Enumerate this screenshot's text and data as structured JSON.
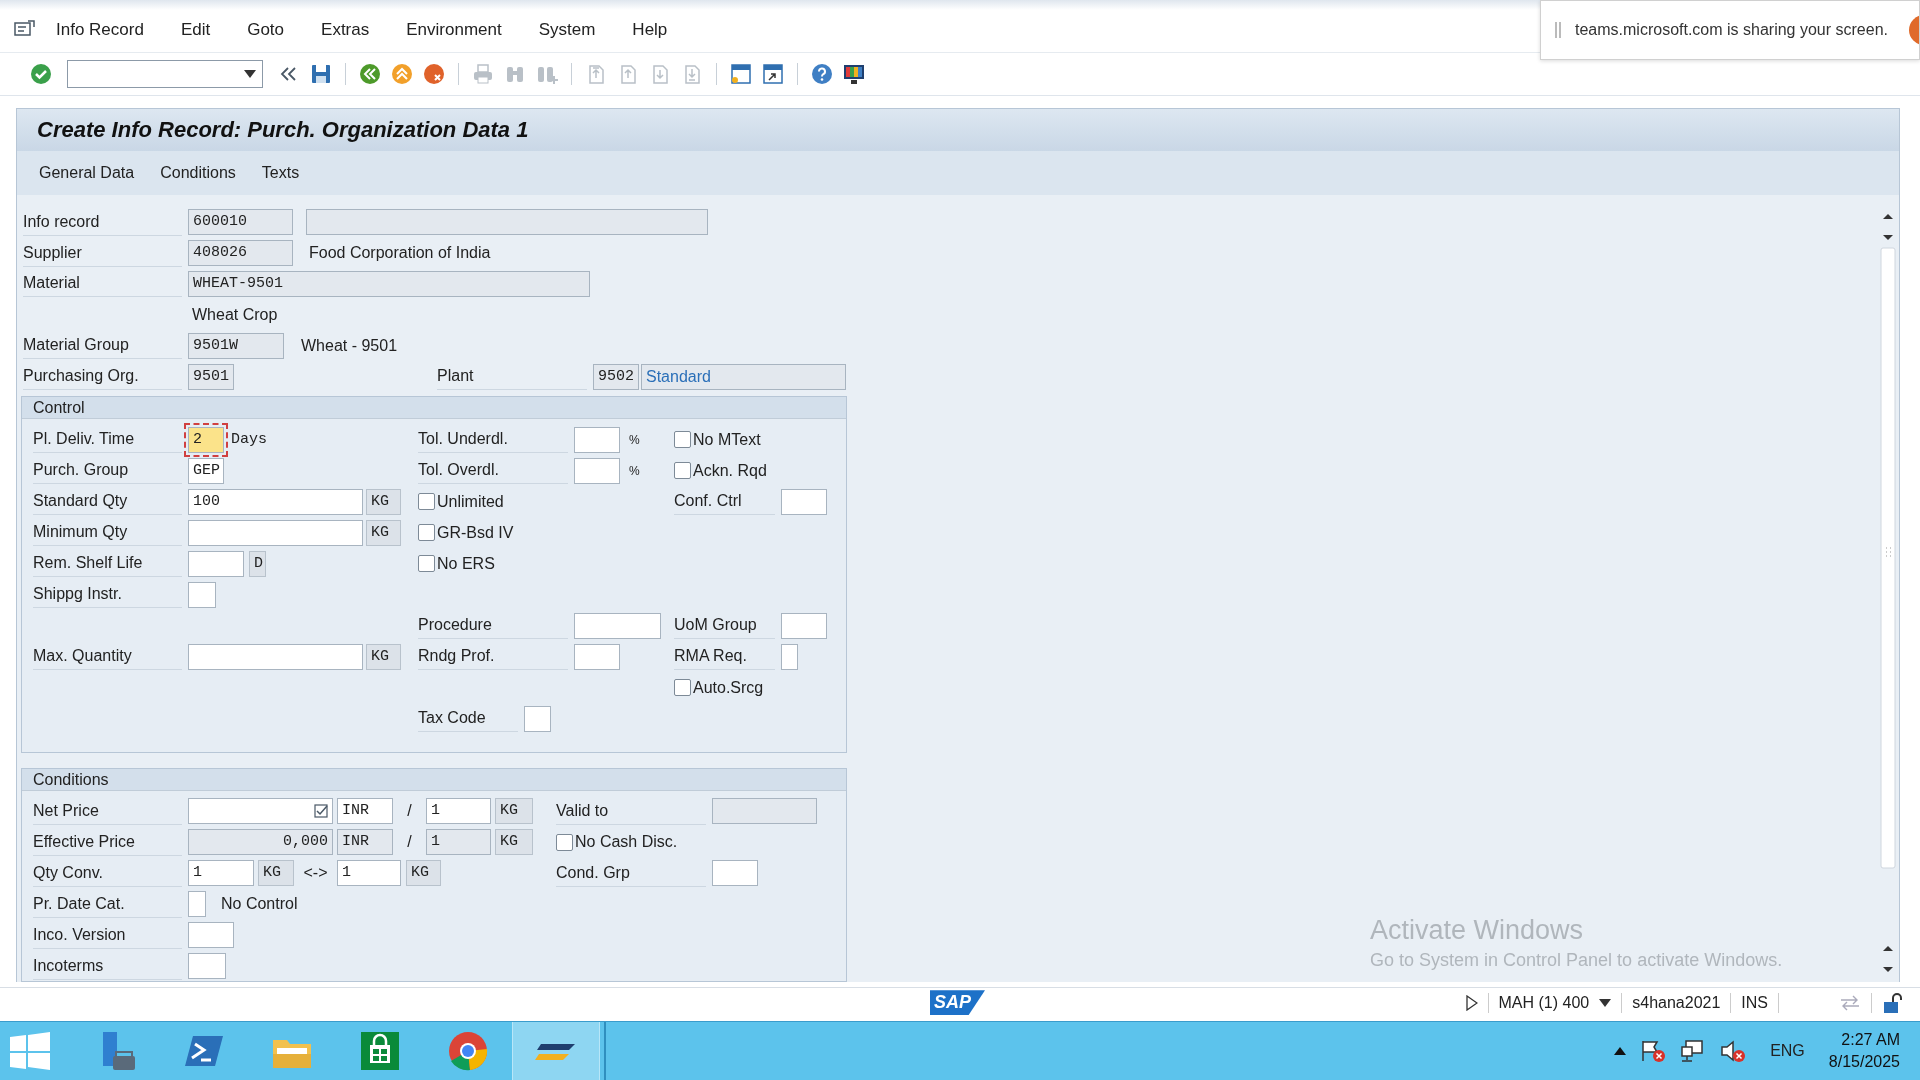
{
  "menu_bar": {
    "items": [
      "Info Record",
      "Edit",
      "Goto",
      "Extras",
      "Environment",
      "System",
      "Help"
    ]
  },
  "toolbar": {
    "groups": [
      [
        {
          "kind": "enter",
          "disabled": false
        },
        {
          "kind": "command"
        },
        {
          "kind": "collapse",
          "disabled": false
        },
        {
          "kind": "save",
          "disabled": false
        }
      ],
      [
        {
          "kind": "back",
          "disabled": false
        },
        {
          "kind": "exit",
          "disabled": false
        },
        {
          "kind": "cancel",
          "disabled": false
        }
      ],
      [
        {
          "kind": "print",
          "disabled": true
        },
        {
          "kind": "find",
          "disabled": true
        },
        {
          "kind": "find-next",
          "disabled": true
        }
      ],
      [
        {
          "kind": "first",
          "disabled": true
        },
        {
          "kind": "prev",
          "disabled": true
        },
        {
          "kind": "next",
          "disabled": true
        },
        {
          "kind": "last",
          "disabled": true
        }
      ],
      [
        {
          "kind": "session",
          "disabled": false
        },
        {
          "kind": "shortcut",
          "disabled": false
        }
      ],
      [
        {
          "kind": "help",
          "disabled": false
        },
        {
          "kind": "customize",
          "disabled": false
        }
      ]
    ]
  },
  "notification": {
    "text": "teams.microsoft.com is sharing your screen."
  },
  "title": "Create Info Record: Purch. Organization Data 1",
  "app_toolbar": [
    "General Data",
    "Conditions",
    "Texts"
  ],
  "header": {
    "info_record": {
      "label": "Info record",
      "value": "600010",
      "editable": false
    },
    "supplier": {
      "label": "Supplier",
      "value": "408026",
      "editable": false,
      "name": "Food Corporation of India"
    },
    "material": {
      "label": "Material",
      "value": "WHEAT-9501",
      "editable": false,
      "description": "Wheat Crop"
    },
    "material_group": {
      "label": "Material Group",
      "value": "9501W",
      "editable": false,
      "description": "Wheat - 9501"
    },
    "purchasing_org": {
      "label": "Purchasing Org.",
      "value": "9501",
      "editable": false
    },
    "plant": {
      "label": "Plant",
      "value": "9502",
      "editable": false,
      "name": "Standard"
    }
  },
  "control": {
    "title": "Control",
    "pl_deliv_time": {
      "label": "Pl. Deliv. Time",
      "value": "2",
      "unit": "Days",
      "focused": true
    },
    "purch_group": {
      "label": "Purch. Group",
      "value": "GEP"
    },
    "standard_qty": {
      "label": "Standard Qty",
      "value": "100",
      "unit": "KG"
    },
    "minimum_qty": {
      "label": "Minimum Qty",
      "unit": "KG"
    },
    "rem_shelf_life": {
      "label": "Rem. Shelf Life",
      "unit": "D"
    },
    "shippg_instr": {
      "label": "Shippg Instr."
    },
    "max_quantity": {
      "label": "Max. Quantity",
      "unit": "KG"
    },
    "tol_underdl": {
      "label": "Tol. Underdl.",
      "unit": "%"
    },
    "tol_overdl": {
      "label": "Tol. Overdl.",
      "unit": "%"
    },
    "unlimited": {
      "label": "Unlimited",
      "checked": false
    },
    "gr_bsd_iv": {
      "label": "GR-Bsd IV",
      "checked": false
    },
    "no_ers": {
      "label": "No ERS",
      "checked": false
    },
    "procedure": {
      "label": "Procedure"
    },
    "rndg_prof": {
      "label": "Rndg Prof."
    },
    "tax_code": {
      "label": "Tax Code"
    },
    "no_mtext": {
      "label": "No MText",
      "checked": false
    },
    "ackn_rqd": {
      "label": "Ackn. Rqd",
      "checked": false
    },
    "conf_ctrl": {
      "label": "Conf. Ctrl"
    },
    "uom_group": {
      "label": "UoM Group"
    },
    "rma_req": {
      "label": "RMA Req."
    },
    "auto_srcg": {
      "label": "Auto.Srcg",
      "checked": false
    }
  },
  "conditions": {
    "title": "Conditions",
    "net_price": {
      "label": "Net Price",
      "currency": "INR",
      "separator": "/",
      "per": "1",
      "unit": "KG",
      "editable": true
    },
    "valid_to": {
      "label": "Valid to",
      "editable": false
    },
    "effective_price": {
      "label": "Effective Price",
      "value": "0,000",
      "currency": "INR",
      "separator": "/",
      "per": "1",
      "unit": "KG",
      "editable": false
    },
    "no_cash_disc": {
      "label": "No Cash Disc.",
      "checked": false
    },
    "qty_conv": {
      "label": "Qty Conv.",
      "value": "1",
      "unit": "KG",
      "separator": "<->",
      "value2": "1",
      "unit2": "KG"
    },
    "cond_grp": {
      "label": "Cond. Grp"
    },
    "pr_date_cat": {
      "label": "Pr. Date Cat.",
      "description": "No Control"
    },
    "inco_version": {
      "label": "Inco. Version"
    },
    "incoterms": {
      "label": "Incoterms"
    }
  },
  "activation_notice": {
    "title": "Activate Windows",
    "text": "Go to System in Control Panel to activate Windows."
  },
  "status_bar": {
    "logo": "SAP",
    "session": "MAH (1) 400",
    "server": "s4hana2021",
    "mode": "INS"
  },
  "taskbar": {
    "apps": [
      {
        "kind": "server-manager",
        "active": false
      },
      {
        "kind": "powershell",
        "active": false
      },
      {
        "kind": "file-explorer",
        "active": false
      },
      {
        "kind": "store",
        "active": false
      },
      {
        "kind": "chrome",
        "active": false
      },
      {
        "kind": "sap-logon",
        "active": true
      }
    ],
    "language": "ENG",
    "time": "2:27 AM",
    "date": "8/15/2025"
  }
}
